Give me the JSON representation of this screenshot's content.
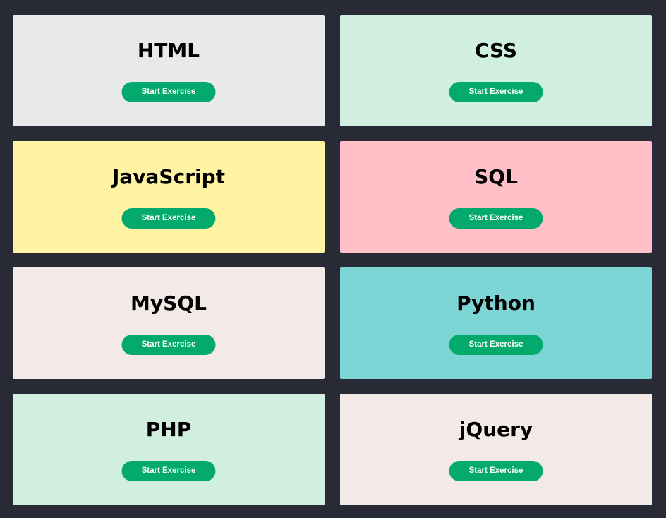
{
  "page": {
    "background": "#282a35",
    "button_color": "#04aa6d",
    "button_text_color": "#ffffff"
  },
  "cards": [
    {
      "title": "HTML",
      "button_label": "Start Exercise",
      "color": "#e7e9eb"
    },
    {
      "title": "CSS",
      "button_label": "Start Exercise",
      "color": "#d1efe1"
    },
    {
      "title": "JavaScript",
      "button_label": "Start Exercise",
      "color": "#fff4a3"
    },
    {
      "title": "SQL",
      "button_label": "Start Exercise",
      "color": "#ffc0c7"
    },
    {
      "title": "MySQL",
      "button_label": "Start Exercise",
      "color": "#f3eae8"
    },
    {
      "title": "Python",
      "button_label": "Start Exercise",
      "color": "#7dd5d5"
    },
    {
      "title": "PHP",
      "button_label": "Start Exercise",
      "color": "#d1efe1"
    },
    {
      "title": "jQuery",
      "button_label": "Start Exercise",
      "color": "#f3eae8"
    }
  ]
}
